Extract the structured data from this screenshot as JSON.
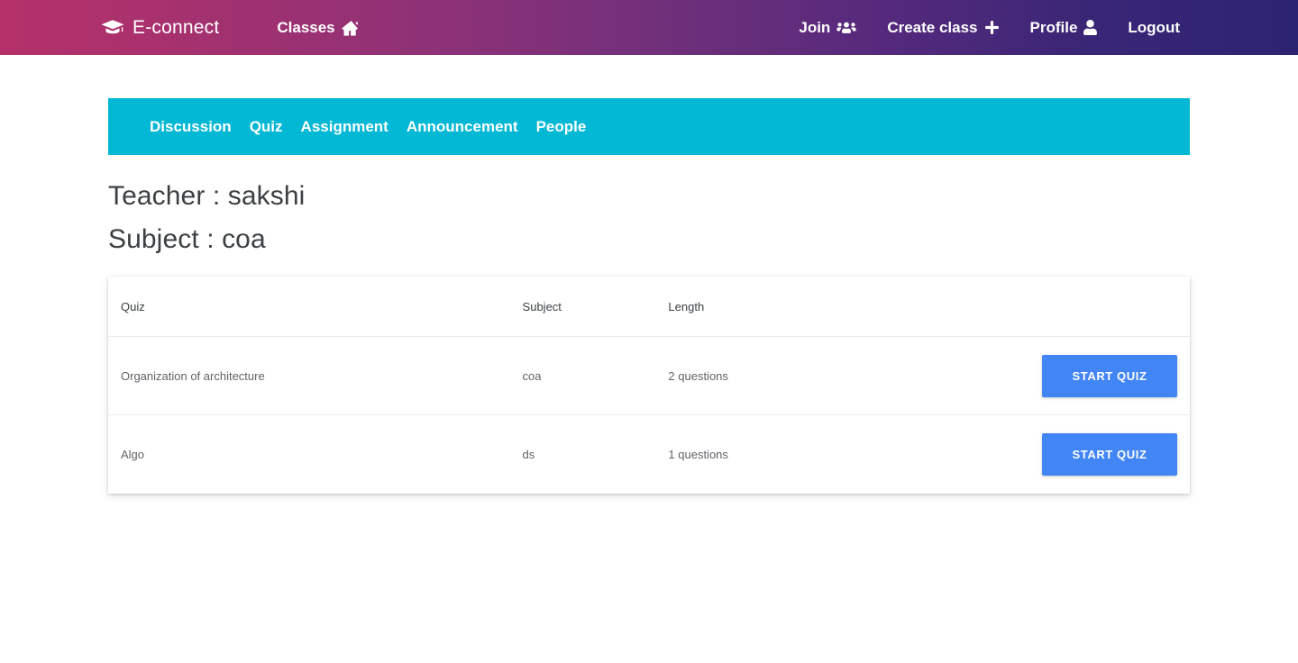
{
  "navbar": {
    "brand": {
      "label": "E-connect",
      "icon": "graduation-cap-icon"
    },
    "classes": {
      "label": "Classes",
      "icon": "home-icon"
    },
    "right_items": [
      {
        "label": "Join",
        "icon": "users-icon"
      },
      {
        "label": "Create class",
        "icon": "plus-icon"
      },
      {
        "label": "Profile",
        "icon": "user-icon"
      },
      {
        "label": "Logout",
        "icon": ""
      }
    ],
    "gradient_start": "#b5316a",
    "gradient_mid": "#72307a",
    "gradient_end": "#2b2472"
  },
  "tabs": [
    {
      "label": "Discussion"
    },
    {
      "label": "Quiz"
    },
    {
      "label": "Assignment"
    },
    {
      "label": "Announcement"
    },
    {
      "label": "People"
    }
  ],
  "tabbar_color": "#03b8d4",
  "class_info": {
    "teacher_line": "Teacher : sakshi",
    "subject_line": "Subject : coa"
  },
  "quiz_table": {
    "columns": [
      "Quiz",
      "Subject",
      "Length"
    ],
    "action_label": "START QUIZ",
    "action_color": "#4285f4",
    "rows": [
      {
        "quiz": "Organization of architecture",
        "subject": "coa",
        "length": "2 questions",
        "action": "START QUIZ"
      },
      {
        "quiz": "Algo",
        "subject": "ds",
        "length": "1 questions",
        "action": "START QUIZ"
      }
    ]
  }
}
